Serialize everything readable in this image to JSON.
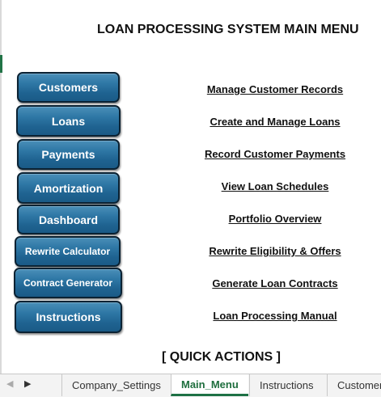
{
  "title": "LOAN PROCESSING SYSTEM MAIN MENU",
  "buttons": [
    {
      "label": "Customers",
      "link": "Manage Customer Records"
    },
    {
      "label": "Loans",
      "link": "Create and Manage Loans"
    },
    {
      "label": "Payments",
      "link": "Record Customer Payments"
    },
    {
      "label": "Amortization",
      "link": "View Loan Schedules"
    },
    {
      "label": "Dashboard",
      "link": "Portfolio Overview"
    },
    {
      "label": "Rewrite Calculator",
      "link": "Rewrite Eligibility & Offers"
    },
    {
      "label": "Contract Generator",
      "link": "Generate Loan Contracts"
    },
    {
      "label": "Instructions",
      "link": "Loan Processing Manual"
    }
  ],
  "quick_actions": "[ QUICK ACTIONS ]",
  "sheet_tabs": {
    "nav_prev": "◀",
    "nav_next": "▶",
    "items": [
      "Company_Settings",
      "Main_Menu",
      "Instructions",
      "Customers"
    ],
    "active": "Main_Menu"
  },
  "colors": {
    "button_fill": "#2f78a6",
    "button_border": "#0b2233",
    "active_tab": "#1e7145"
  }
}
